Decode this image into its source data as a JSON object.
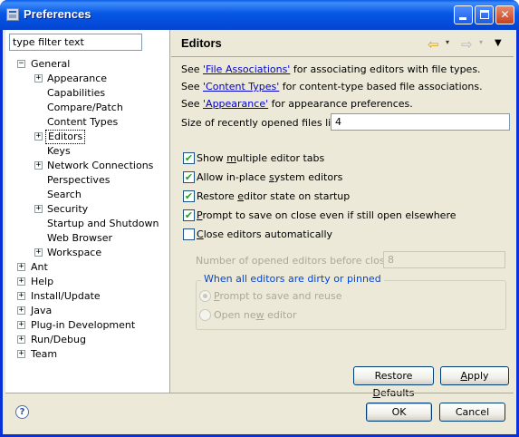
{
  "window": {
    "title": "Preferences"
  },
  "filter": {
    "placeholder": "type filter text"
  },
  "tree": [
    {
      "label": "General",
      "expander": "−"
    },
    {
      "label": "Appearance",
      "expander": "+"
    },
    {
      "label": "Capabilities",
      "expander": ""
    },
    {
      "label": "Compare/Patch",
      "expander": ""
    },
    {
      "label": "Content Types",
      "expander": ""
    },
    {
      "label": "Editors",
      "expander": "+",
      "selected": true
    },
    {
      "label": "Keys",
      "expander": ""
    },
    {
      "label": "Network Connections",
      "expander": "+"
    },
    {
      "label": "Perspectives",
      "expander": ""
    },
    {
      "label": "Search",
      "expander": ""
    },
    {
      "label": "Security",
      "expander": "+"
    },
    {
      "label": "Startup and Shutdown",
      "expander": ""
    },
    {
      "label": "Web Browser",
      "expander": ""
    },
    {
      "label": "Workspace",
      "expander": "+"
    },
    {
      "label": "Ant",
      "expander": "+"
    },
    {
      "label": "Help",
      "expander": "+"
    },
    {
      "label": "Install/Update",
      "expander": "+"
    },
    {
      "label": "Java",
      "expander": "+"
    },
    {
      "label": "Plug-in Development",
      "expander": "+"
    },
    {
      "label": "Run/Debug",
      "expander": "+"
    },
    {
      "label": "Team",
      "expander": "+"
    }
  ],
  "page": {
    "title": "Editors",
    "nav": {
      "back": "⇦",
      "forward": "⇨",
      "dropdown": "▾",
      "menu": "▼"
    },
    "info": [
      {
        "pre": "See ",
        "link": "'File Associations'",
        "post": " for associating editors with file types."
      },
      {
        "pre": "See ",
        "link": "'Content Types'",
        "post": " for content-type based file associations."
      },
      {
        "pre": "See ",
        "link": "'Appearance'",
        "post": " for appearance preferences."
      }
    ],
    "recent_label": "Size of recently opened files list:",
    "recent_value": "4",
    "options": [
      {
        "pre": "Show ",
        "u": "m",
        "post": "ultiple editor tabs",
        "checked": true
      },
      {
        "pre": "Allow in-place ",
        "u": "s",
        "post": "ystem editors",
        "checked": true
      },
      {
        "pre": "Restore ",
        "u": "e",
        "post": "ditor state on startup",
        "checked": true
      },
      {
        "pre": "",
        "u": "P",
        "post": "rompt to save on close even if still open elsewhere",
        "checked": true
      },
      {
        "pre": "",
        "u": "C",
        "post": "lose editors automatically",
        "checked": false
      }
    ],
    "check_glyph": "✔",
    "closing_label": "Number of opened editors before closing:",
    "closing_value": "8",
    "dirty_group": {
      "legend": "When all editors are dirty or pinned",
      "radios": [
        {
          "pre": "",
          "u": "P",
          "post": "rompt to save and reuse",
          "selected": true
        },
        {
          "pre": "Open ne",
          "u": "w",
          "post": " editor",
          "selected": false
        }
      ]
    },
    "restore_defaults": {
      "pre": "Restore ",
      "u": "D",
      "post": "efaults"
    },
    "apply": {
      "pre": "",
      "u": "A",
      "post": "pply"
    }
  },
  "footer": {
    "ok": "OK",
    "cancel": "Cancel",
    "help_glyph": "?"
  },
  "colors": {
    "titlebar": "#0a5ce8",
    "link": "#0000cc",
    "group_legend": "#0046d5",
    "dialog_bg": "#ece9d8"
  }
}
